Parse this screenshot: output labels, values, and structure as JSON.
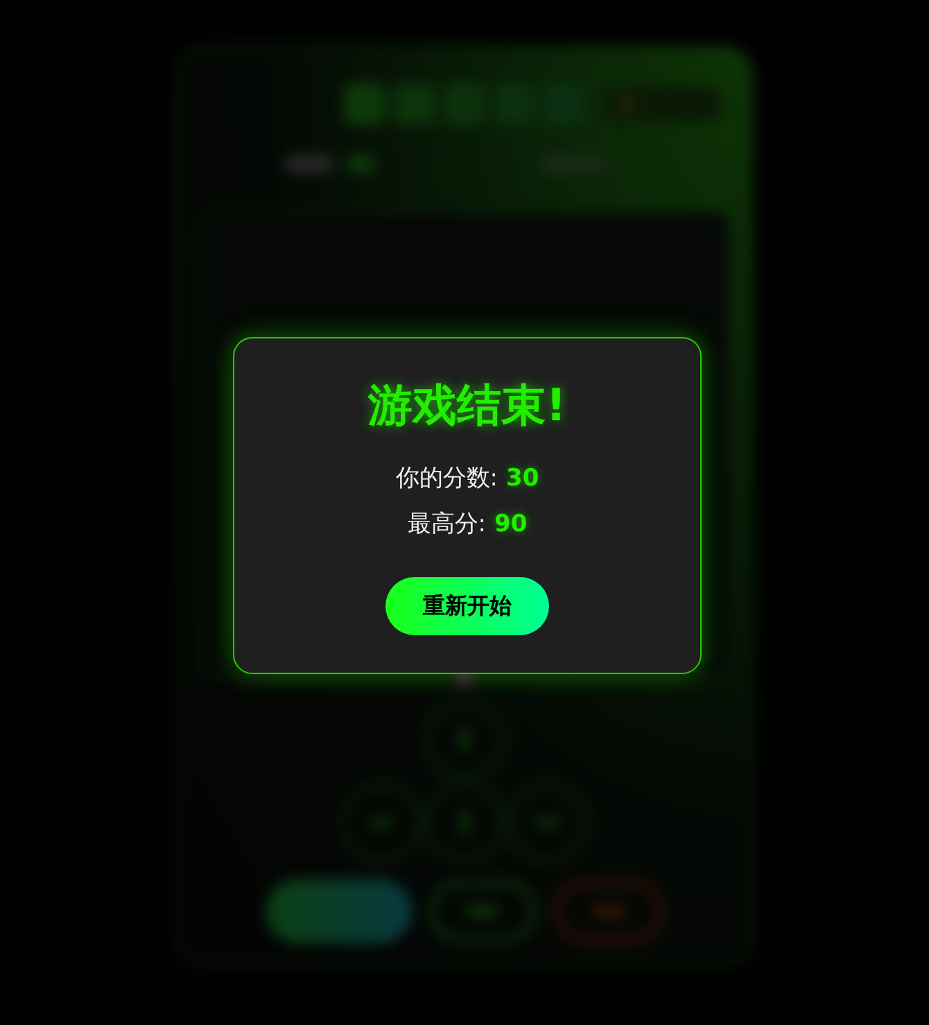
{
  "dialog": {
    "title": "游戏结束!",
    "stats": [
      {
        "label": "你的分数:",
        "value": "30"
      },
      {
        "label": "最高分:",
        "value": "90"
      }
    ],
    "button": "重新开始"
  }
}
